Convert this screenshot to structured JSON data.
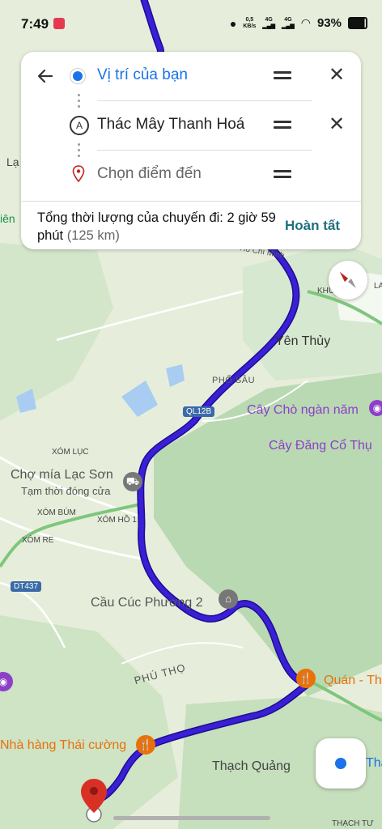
{
  "status_bar": {
    "time": "7:49",
    "net_speed_value": "0,5",
    "net_speed_unit": "KB/s",
    "signal_1": "4G",
    "signal_2": "4G",
    "battery": "93%"
  },
  "directions": {
    "origin": "Vị trí của bạn",
    "waypoint": "Thác Mây Thanh Hoá",
    "waypoint_marker": "A",
    "destination_placeholder": "Chọn điểm đến",
    "summary_text": "Tổng thời lượng của chuyến đi: 2 giờ 59 phút",
    "summary_distance": "(125 km)",
    "done_label": "Hoàn tất"
  },
  "map_labels": {
    "yen_thuy": "Yên Thủy",
    "pho_sau": "PHỐ SÂU",
    "ql12b": "QL12B",
    "cay_cho": "Cây Chò ngàn năm",
    "cay_dang": "Cây Đăng Cổ Thụ",
    "xom_luc": "XÓM LỤC",
    "cho_mia": "Chợ mía Lạc Sơn",
    "cho_mia_status": "Tạm thời đóng cửa",
    "xom_bum": "XÓM BÚM",
    "xom_ho": "XÓM HỒ 1",
    "xom_re": "XÓM RE",
    "dt437": "DT437",
    "cau_cuc_phuong": "Cầu Cúc Phương 2",
    "phu_tho": "PHÚ THỌ",
    "quan": "Quán - Th",
    "nha_hang": "Nhà hàng Thái cường",
    "thach_quang": "Thạch Quảng",
    "thach_tu": "THẠCH TƯ",
    "thach_right": "Thạ",
    "la": "Lạ",
    "lien": "iên",
    "khu": "KHU",
    "la_right": "LA",
    "ho_chi_minh": "Hồ Chí Minh"
  },
  "colors": {
    "route": "#3a1fd6",
    "accent_blue": "#1a73e8",
    "done_teal": "#1e6f7e",
    "poi_purple": "#8e3fc8",
    "poi_orange": "#e8710a",
    "pin_red": "#d93025"
  },
  "icons": [
    "back-arrow-icon",
    "origin-dot-icon",
    "waypoint-a-icon",
    "destination-pin-icon",
    "drag-handle-icon",
    "close-icon",
    "compass-icon",
    "my-location-icon",
    "restaurant-icon",
    "camera-icon",
    "bridge-icon",
    "shopping-icon"
  ]
}
